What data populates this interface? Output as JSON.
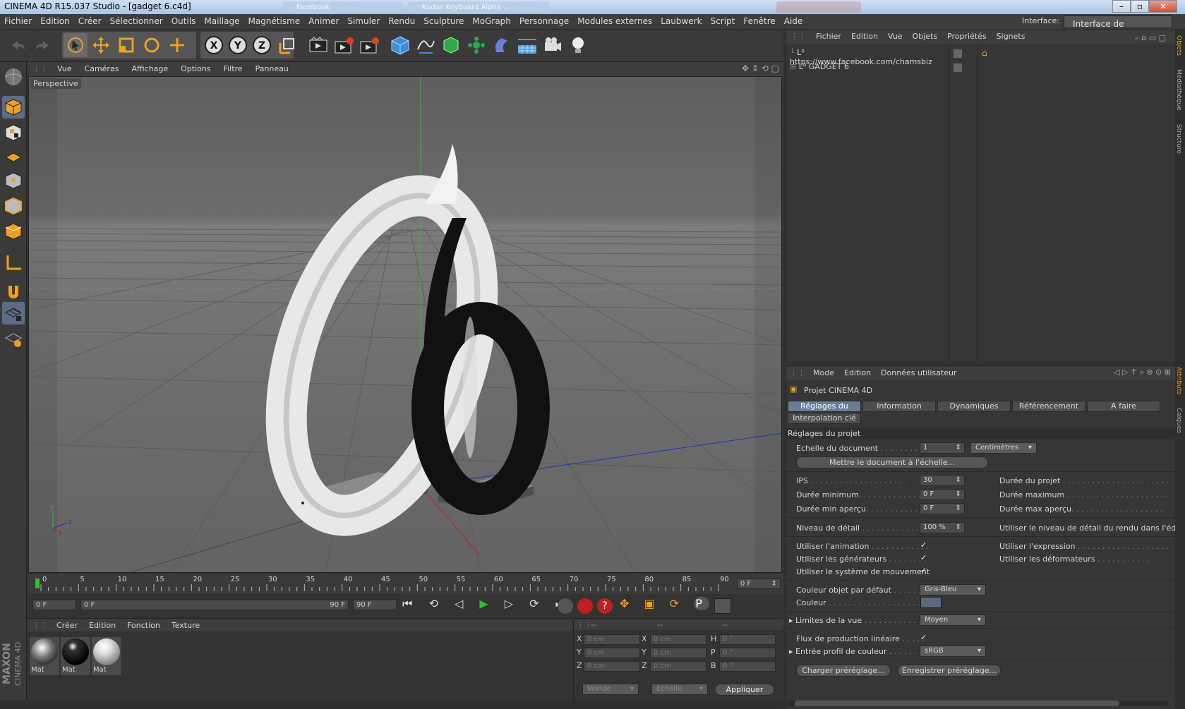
{
  "window": {
    "title": "CINEMA 4D R15.037 Studio - [gadget 6.c4d]",
    "ghost_tabs": [
      "Facebook",
      "Kudos Keyboard Alpha ...",
      ""
    ]
  },
  "menubar": {
    "items": [
      "Fichier",
      "Edition",
      "Créer",
      "Sélectionner",
      "Outils",
      "Maillage",
      "Magnétisme",
      "Animer",
      "Simuler",
      "Rendu",
      "Sculpture",
      "MoGraph",
      "Personnage",
      "Modules externes",
      "Laubwerk",
      "Script",
      "Fenêtre",
      "Aide"
    ],
    "interface_label": "Interface:",
    "interface_value": "Interface de démarrage"
  },
  "toolbar": {
    "icons": [
      "undo-icon",
      "redo-icon",
      "select-icon",
      "move-icon",
      "scale-icon",
      "rotate-icon",
      "last-tool-icon",
      "x-axis-icon",
      "y-axis-icon",
      "z-axis-icon",
      "coord-system-icon",
      "render-view-icon",
      "render-picture-viewer-icon",
      "render-settings-icon",
      "cube-icon",
      "spline-icon",
      "nurbs-icon",
      "array-icon",
      "deformer-icon",
      "scene-icon",
      "camera-icon",
      "light-icon"
    ],
    "axis_labels": [
      "X",
      "Y",
      "Z"
    ]
  },
  "viewport": {
    "menu": [
      "Vue",
      "Caméras",
      "Affichage",
      "Options",
      "Filtre",
      "Panneau"
    ],
    "label": "Perspective",
    "axis_y": "y",
    "axis_x": "x",
    "axis_z": "z"
  },
  "timeline": {
    "ticks": [
      "0",
      "5",
      "10",
      "15",
      "20",
      "25",
      "30",
      "35",
      "40",
      "45",
      "50",
      "55",
      "60",
      "65",
      "70",
      "75",
      "80",
      "85",
      "90"
    ],
    "current_frame": "0 F"
  },
  "transport": {
    "start": "0 F",
    "range_start": "0 F",
    "range_end": "90 F",
    "end": "90 F"
  },
  "material_manager": {
    "menu": [
      "Créer",
      "Edition",
      "Fonction",
      "Texture"
    ],
    "materials": [
      {
        "label": "Mat",
        "style": "chrome"
      },
      {
        "label": "Mat",
        "style": "black"
      },
      {
        "label": "Mat",
        "style": "white"
      }
    ],
    "logo_top": "MAXON",
    "logo_bottom": "CINEMA 4D"
  },
  "coords": {
    "headers": [
      "--",
      "--",
      "--"
    ],
    "rows": [
      {
        "a": "X",
        "av": "0 cm",
        "b": "X",
        "bv": "0 cm",
        "c": "H",
        "cv": "0 °"
      },
      {
        "a": "Y",
        "av": "0 cm",
        "b": "Y",
        "bv": "0 cm",
        "c": "P",
        "cv": "0 °"
      },
      {
        "a": "Z",
        "av": "0 cm",
        "b": "Z",
        "bv": "0 cm",
        "c": "B",
        "cv": "0 °"
      }
    ],
    "mode1": "Monde",
    "mode2": "Echelle",
    "apply": "Appliquer"
  },
  "object_manager": {
    "menu": [
      "Fichier",
      "Edition",
      "Vue",
      "Objets",
      "Propriétés",
      "Signets"
    ],
    "objects": [
      {
        "name": "https://www.facebook.com/chamsbiz"
      },
      {
        "name": "GADGET 6"
      }
    ]
  },
  "attributes": {
    "menu": [
      "Mode",
      "Edition",
      "Données utilisateur"
    ],
    "object_title": "Projet CINEMA 4D",
    "tabs": [
      "Réglages du projet",
      "Information",
      "Dynamiques",
      "Référencement",
      "A faire",
      "Interpolation clé"
    ],
    "section": "Réglages du projet",
    "doc_scale_label": "Echelle du document",
    "doc_scale_value": "1",
    "doc_scale_unit": "Centimètres",
    "scale_button": "Mettre le document à l'échelle...",
    "ips_label": "IPS",
    "ips_value": "30",
    "min_label": "Durée minimum",
    "min_value": "0 F",
    "preview_min_label": "Durée min aperçu",
    "preview_min_value": "0 F",
    "project_time_label": "Durée du projet",
    "max_label": "Durée maximum",
    "preview_max_label": "Durée max aperçu",
    "lod_label": "Niveau de détail",
    "lod_value": "100 %",
    "render_lod_label": "Utiliser le niveau de détail du rendu dans l'édit",
    "use_anim_label": "Utiliser l'animation",
    "use_expr_label": "Utiliser l'expression",
    "use_gen_label": "Utiliser les générateurs",
    "use_deform_label": "Utiliser les déformateurs",
    "use_motion_label": "Utiliser le système de mouvement",
    "color_default_label": "Couleur objet par défaut",
    "color_default_value": "Gris-Bleu",
    "color_label": "Couleur",
    "view_limits_label": "Limites de la vue",
    "view_limits_value": "Moyen",
    "linear_label": "Flux de production linéaire",
    "color_profile_label": "Entrée profil de couleur",
    "color_profile_value": "sRGB",
    "load_preset": "Charger préréglage...",
    "save_preset": "Enregistrer préréglage...",
    "check_mark": "✓",
    "swatch_color": "#5b6a80"
  },
  "right_strip": [
    "Objets",
    "Médiathèque",
    "Structure",
    "Attributs",
    "Calques"
  ],
  "accent": "#f0a020"
}
